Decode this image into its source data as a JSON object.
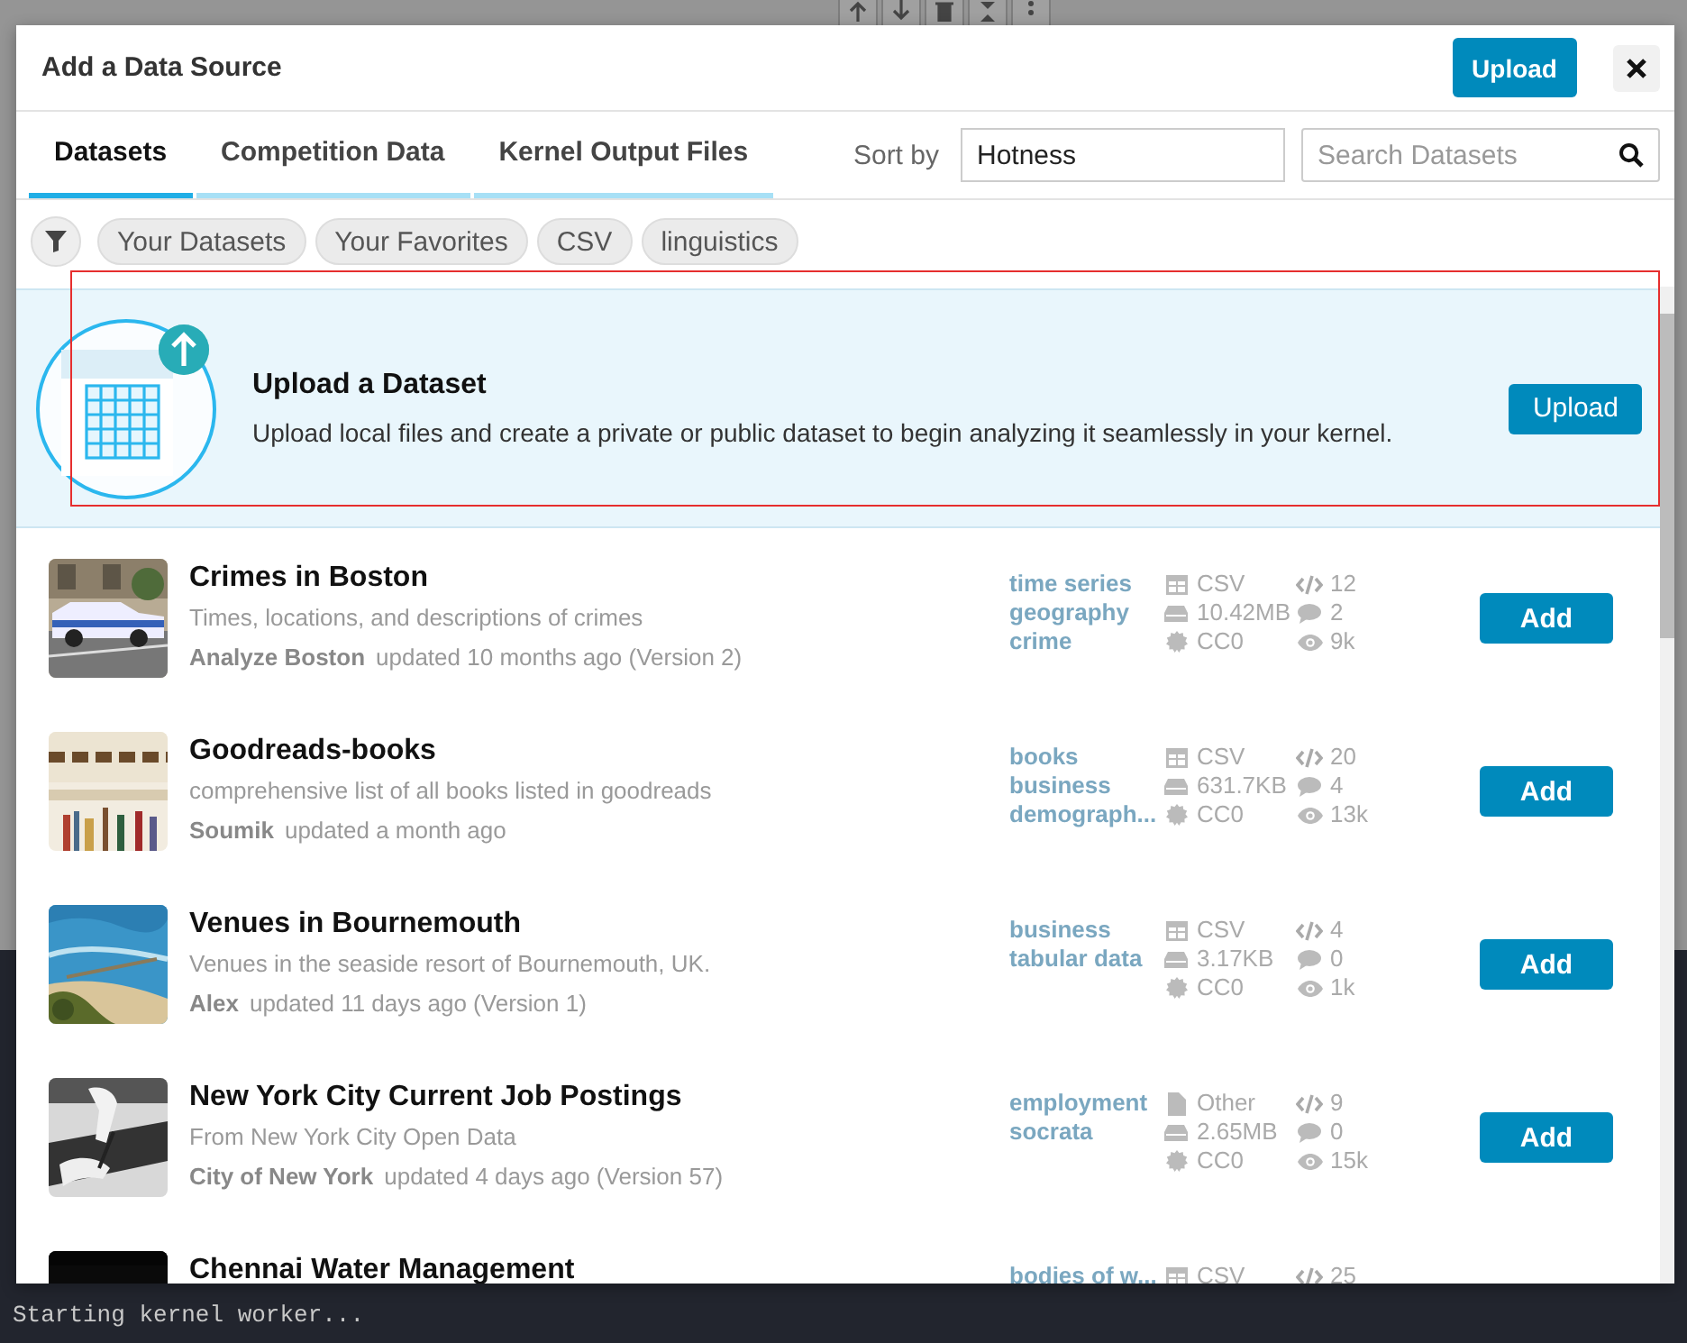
{
  "console": {
    "line": "Starting kernel worker..."
  },
  "dialog": {
    "title": "Add a Data Source",
    "upload_button": "Upload",
    "tabs": [
      {
        "label": "Datasets",
        "selected": true
      },
      {
        "label": "Competition Data",
        "selected": false
      },
      {
        "label": "Kernel Output Files",
        "selected": false
      }
    ],
    "sort": {
      "label": "Sort by",
      "value": "Hotness"
    },
    "search": {
      "placeholder": "Search Datasets"
    },
    "filters": [
      "Your Datasets",
      "Your Favorites",
      "CSV",
      "linguistics"
    ],
    "upload_banner": {
      "title": "Upload a Dataset",
      "description": "Upload local files and create a private or public dataset to begin analyzing it seamlessly in your kernel.",
      "button": "Upload"
    },
    "datasets": [
      {
        "title": "Crimes in Boston",
        "description": "Times, locations, and descriptions of crimes",
        "owner": "Analyze Boston",
        "updated": "updated 10 months ago (Version 2)",
        "tags": [
          "time series",
          "geography",
          "crime"
        ],
        "stats_left": [
          {
            "kind": "table",
            "text": "CSV"
          },
          {
            "kind": "drive",
            "text": "10.42MB"
          },
          {
            "kind": "license",
            "text": "CC0"
          }
        ],
        "stats_right": [
          {
            "kind": "code",
            "text": "12"
          },
          {
            "kind": "comment",
            "text": "2"
          },
          {
            "kind": "eye",
            "text": "9k"
          }
        ],
        "button": "Add"
      },
      {
        "title": "Goodreads-books",
        "description": "comprehensive list of all books listed in goodreads",
        "owner": "Soumik",
        "updated": "updated a month ago",
        "tags": [
          "books",
          "business",
          "demograph..."
        ],
        "stats_left": [
          {
            "kind": "table",
            "text": "CSV"
          },
          {
            "kind": "drive",
            "text": "631.7KB"
          },
          {
            "kind": "license",
            "text": "CC0"
          }
        ],
        "stats_right": [
          {
            "kind": "code",
            "text": "20"
          },
          {
            "kind": "comment",
            "text": "4"
          },
          {
            "kind": "eye",
            "text": "13k"
          }
        ],
        "button": "Add"
      },
      {
        "title": "Venues in Bournemouth",
        "description": "Venues in the seaside resort of Bournemouth, UK.",
        "owner": "Alex",
        "updated": "updated 11 days ago (Version 1)",
        "tags": [
          "business",
          "tabular data"
        ],
        "stats_left": [
          {
            "kind": "table",
            "text": "CSV"
          },
          {
            "kind": "drive",
            "text": "3.17KB"
          },
          {
            "kind": "license",
            "text": "CC0"
          }
        ],
        "stats_right": [
          {
            "kind": "code",
            "text": "4"
          },
          {
            "kind": "comment",
            "text": "0"
          },
          {
            "kind": "eye",
            "text": "1k"
          }
        ],
        "button": "Add"
      },
      {
        "title": "New York City Current Job Postings",
        "description": "From New York City Open Data",
        "owner": "City of New York",
        "updated": "updated 4 days ago (Version 57)",
        "tags": [
          "employment",
          "socrata"
        ],
        "stats_left": [
          {
            "kind": "file",
            "text": "Other"
          },
          {
            "kind": "drive",
            "text": "2.65MB"
          },
          {
            "kind": "license",
            "text": "CC0"
          }
        ],
        "stats_right": [
          {
            "kind": "code",
            "text": "9"
          },
          {
            "kind": "comment",
            "text": "0"
          },
          {
            "kind": "eye",
            "text": "15k"
          }
        ],
        "button": "Add"
      },
      {
        "title": "Chennai Water Management",
        "tags": [
          "bodies of w..."
        ],
        "stats_left": [
          {
            "kind": "table",
            "text": "CSV"
          }
        ],
        "stats_right": [
          {
            "kind": "code",
            "text": "25"
          }
        ]
      }
    ]
  }
}
